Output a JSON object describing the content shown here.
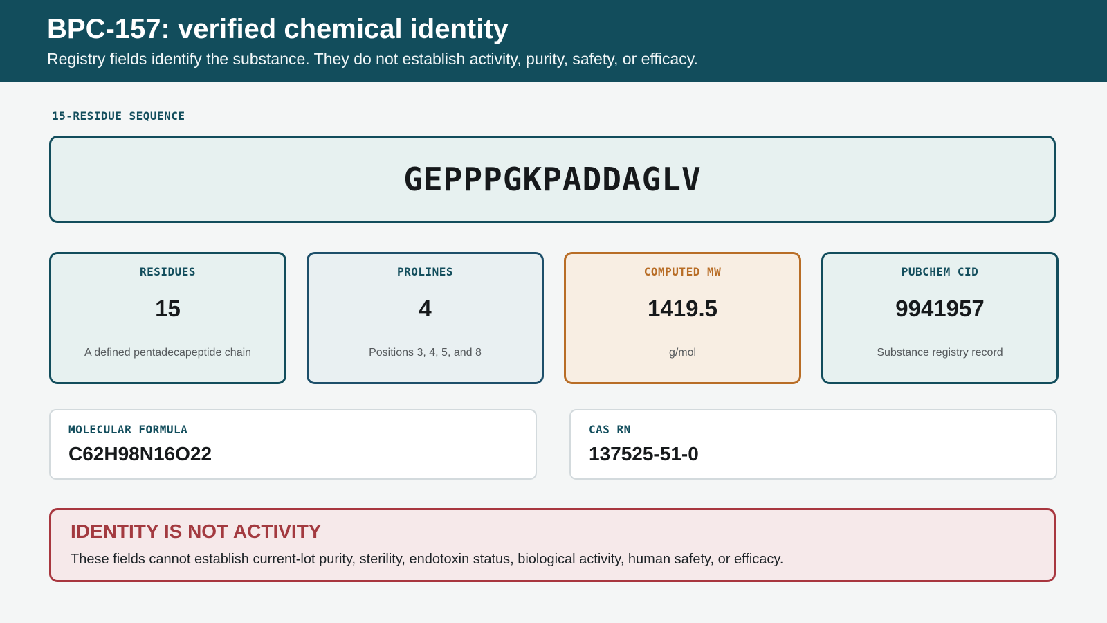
{
  "header": {
    "title": "BPC-157: verified chemical identity",
    "subtitle": "Registry fields identify the substance. They do not establish activity, purity, safety, or efficacy."
  },
  "sequence": {
    "label": "15-RESIDUE SEQUENCE",
    "value": "GEPPPGKPADDAGLV"
  },
  "stats": [
    {
      "label": "RESIDUES",
      "value": "15",
      "note": "A defined pentadecapeptide chain"
    },
    {
      "label": "PROLINES",
      "value": "4",
      "note": "Positions 3, 4, 5, and 8"
    },
    {
      "label": "COMPUTED MW",
      "value": "1419.5",
      "note": "g/mol"
    },
    {
      "label": "PUBCHEM CID",
      "value": "9941957",
      "note": "Substance registry record"
    }
  ],
  "fields": [
    {
      "label": "MOLECULAR FORMULA",
      "value": "C62H98N16O22"
    },
    {
      "label": "CAS RN",
      "value": "137525-51-0"
    }
  ],
  "warning": {
    "title": "IDENTITY IS NOT ACTIVITY",
    "text": "These fields cannot establish current-lot purity, sterility, endotoxin status, biological activity, human safety, or efficacy."
  },
  "colors": {
    "header_bg": "#124d5c",
    "accent_teal": "#124d5c",
    "accent_orange": "#b86d26",
    "warning_red": "#a33a40"
  }
}
